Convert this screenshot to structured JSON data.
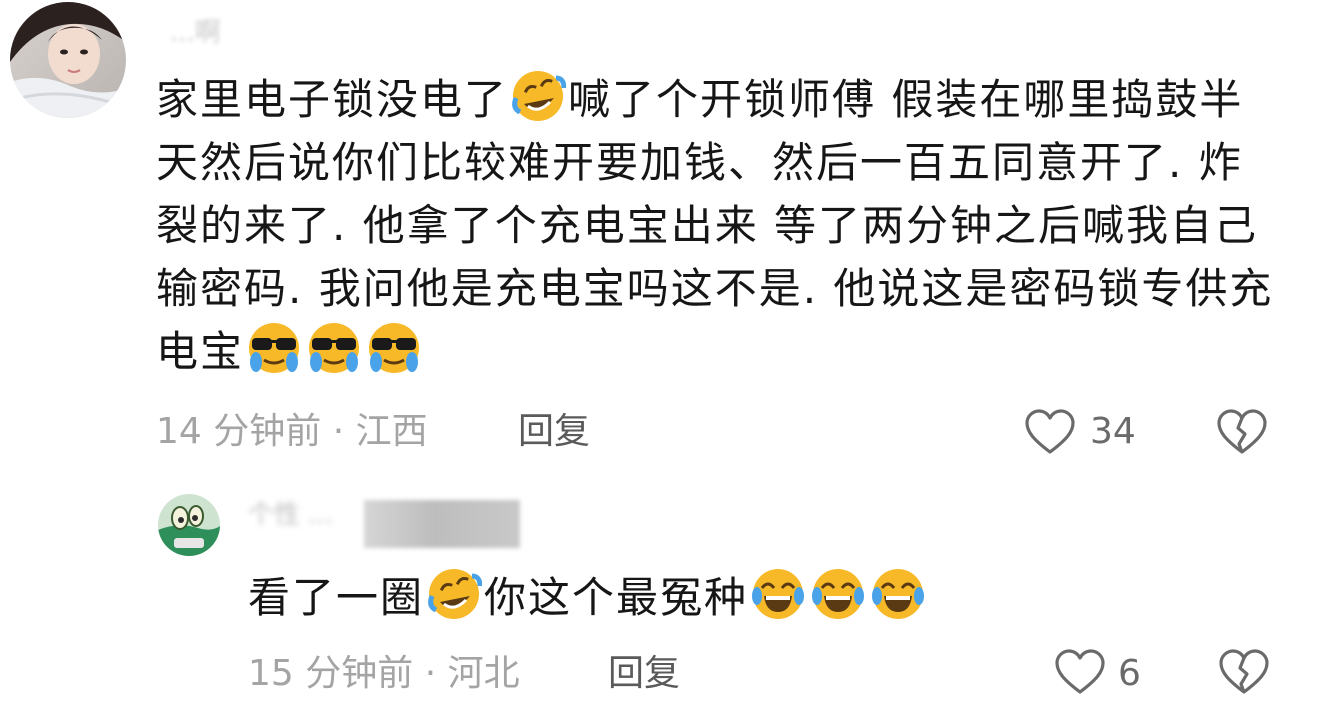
{
  "comments": [
    {
      "username": "...啊",
      "avatar_icon": "avatar-girl-photo",
      "text_parts": [
        "家里电子锁没电了",
        "喊了个开锁师傅 假装在哪里捣鼓半天然后说你们比较难开要加钱、然后一百五同意开了. 炸裂的来了. 他拿了个充电宝出来 等了两分钟之后喊我自己输密码. 我问他是充电宝吗这不是. 他说这是密码锁专供充电宝"
      ],
      "inline_emoji": "rofl-emoji",
      "trailing_emoji": [
        "sunglasses-crying-emoji",
        "sunglasses-crying-emoji",
        "sunglasses-crying-emoji"
      ],
      "meta": "14 分钟前 · 江西",
      "reply_label": "回复",
      "likes": "34"
    },
    {
      "username": "个性 ...",
      "avatar_icon": "avatar-cartoon-green",
      "text_parts": [
        "看了一圈",
        "你这个最冤种"
      ],
      "inline_emoji": "rofl-emoji",
      "trailing_emoji": [
        "laughing-tears-emoji",
        "laughing-tears-emoji",
        "laughing-tears-emoji"
      ],
      "meta": "15 分钟前 · 河北",
      "reply_label": "回复",
      "likes": "6"
    }
  ],
  "colors": {
    "text": "#161616",
    "meta": "#a4a4a4",
    "reply": "#5a5a5a",
    "icon": "#6a6a6a",
    "emoji_yellow": "#f7b928"
  }
}
